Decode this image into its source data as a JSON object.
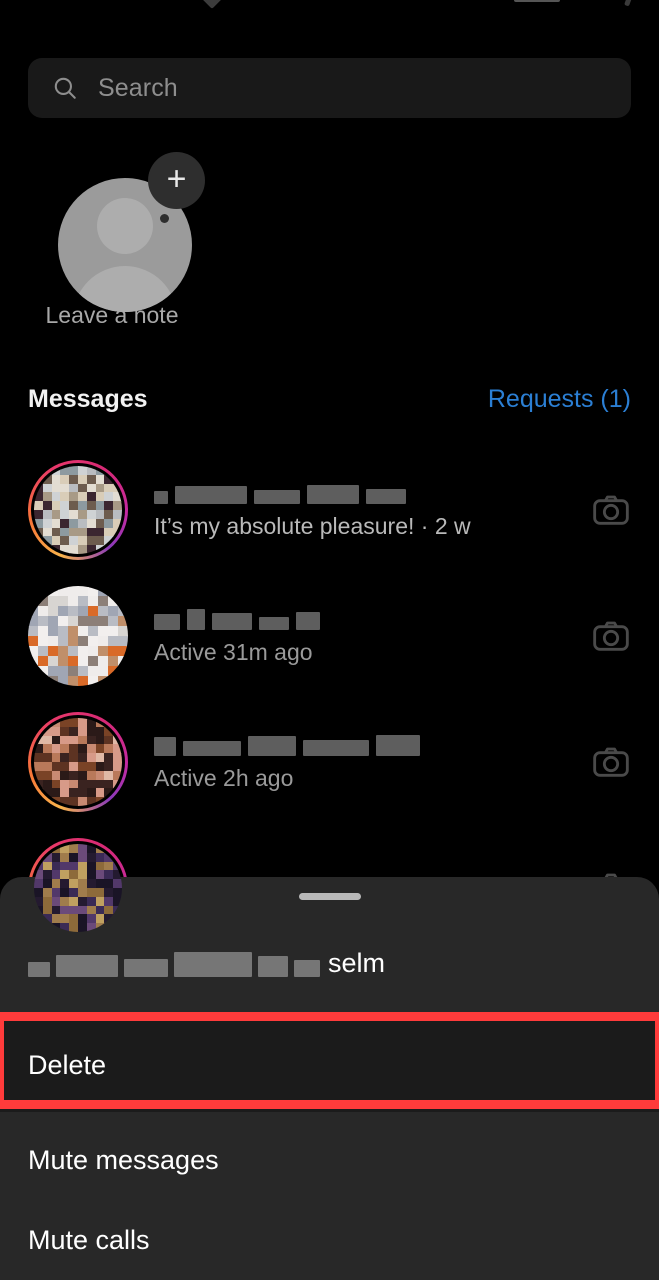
{
  "app": {
    "name": "Instagram Direct Messages",
    "background_color": "#000000",
    "accent_color": "#2b7fd4",
    "annotation_color": "#ff3b3b"
  },
  "header": {
    "partial_icons": [
      "chevron-glyph",
      "toggle-bar-glyph",
      "tick-glyph"
    ]
  },
  "search": {
    "placeholder": "Search",
    "value": "",
    "icon": "search-icon"
  },
  "note": {
    "avatar": "default-user-avatar",
    "add_icon": "plus-icon",
    "label": "Leave a note"
  },
  "messages_header": {
    "title": "Messages",
    "requests_label": "Requests (1)",
    "requests_count": 1
  },
  "conversations": [
    {
      "username_redacted": true,
      "name_blocks": [
        14,
        72,
        46,
        52,
        40
      ],
      "preview": "It’s my absolute pleasure! · 2 w",
      "timestamp": "2 w",
      "has_story_ring": true,
      "action_icon": "camera-icon"
    },
    {
      "username_redacted": true,
      "name_blocks": [
        26,
        18,
        40,
        30,
        24
      ],
      "preview": "Active 31m ago",
      "timestamp": "31m",
      "has_story_ring": false,
      "action_icon": "camera-icon"
    },
    {
      "username_redacted": true,
      "name_blocks": [
        22,
        58,
        48,
        66,
        44
      ],
      "preview": "Active 2h ago",
      "timestamp": "2h",
      "has_story_ring": true,
      "action_icon": "camera-icon"
    },
    {
      "username_redacted": true,
      "name_blocks": [
        30,
        54,
        38,
        60
      ],
      "preview": "",
      "timestamp": "",
      "has_story_ring": true,
      "action_icon": "camera-icon"
    }
  ],
  "bottom_sheet": {
    "handle": "drag-handle",
    "title_redacted": true,
    "title_blocks": [
      22,
      62,
      44,
      78,
      30,
      26
    ],
    "title_visible_tail": "selm",
    "items": [
      {
        "label": "Delete",
        "highlighted": true
      },
      {
        "label": "Mute messages",
        "highlighted": false
      },
      {
        "label": "Mute calls",
        "highlighted": false
      }
    ]
  }
}
